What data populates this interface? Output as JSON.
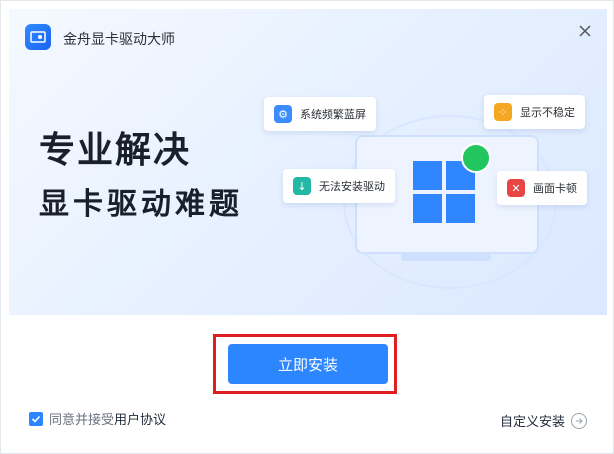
{
  "app": {
    "title": "金舟显卡驱动大师"
  },
  "headline": {
    "line1": "专业解决",
    "line2": "显卡驱动难题"
  },
  "cards": [
    {
      "label": "系统频繁蓝屏",
      "icon": "gear-screen-icon"
    },
    {
      "label": "显示不稳定",
      "icon": "loading-dots-icon"
    },
    {
      "label": "无法安装驱动",
      "icon": "download-icon"
    },
    {
      "label": "画面卡顿",
      "icon": "error-monitor-icon"
    }
  ],
  "install_button": {
    "label": "立即安装"
  },
  "agreement": {
    "prefix": "同意并接受",
    "link": "用户协议",
    "checked": true
  },
  "custom_install": {
    "label": "自定义安装"
  },
  "colors": {
    "accent": "#2b86ff",
    "highlight": "#e02020"
  }
}
